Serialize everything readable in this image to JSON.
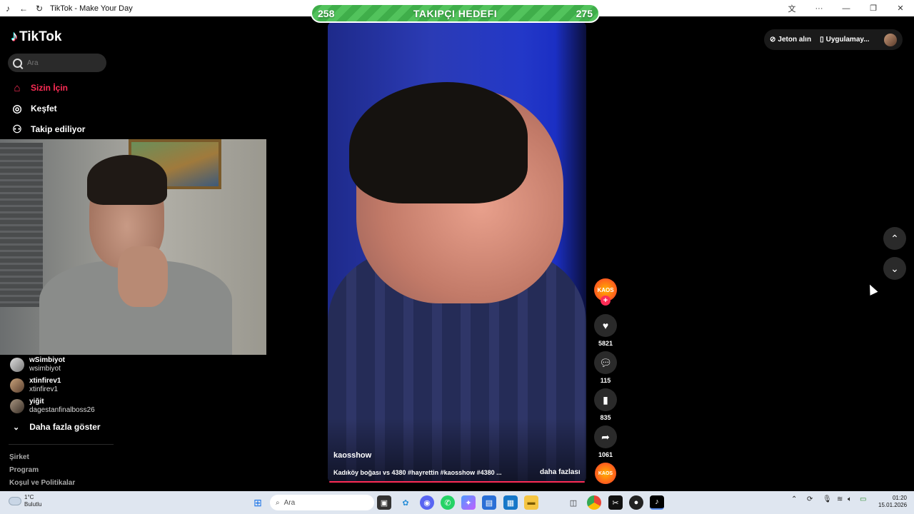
{
  "browser": {
    "tab_title": "TikTok - Make Your Day"
  },
  "goal": {
    "current": "258",
    "title": "TAKIPÇI HEDEFI",
    "target": "275"
  },
  "sidebar": {
    "logo": "TikTok",
    "search_placeholder": "Ara",
    "nav": [
      {
        "label": "Sizin İçin",
        "icon": "home-icon"
      },
      {
        "label": "Keşfet",
        "icon": "compass-icon"
      },
      {
        "label": "Takip ediliyor",
        "icon": "following-icon"
      }
    ],
    "following": [
      {
        "name": "wSimbiyot",
        "username": "wsimbiyot"
      },
      {
        "name": "xtinfirev1",
        "username": "xtinfirev1"
      },
      {
        "name": "yiğit",
        "username": "dagestanfinalboss26"
      }
    ],
    "more_label": "Daha fazla göster",
    "footer": [
      "Şirket",
      "Program",
      "Koşul ve Politikalar"
    ]
  },
  "video": {
    "author": "kaosshow",
    "caption": "Kadıköy boğası vs 4380 #hayrettin #kaosshow #4380 ...",
    "more_label": "daha fazlası",
    "creator_badge": "KAOS",
    "stats": {
      "likes": "5821",
      "comments": "115",
      "saves": "835",
      "shares": "1061"
    }
  },
  "topright": {
    "coin_label": "Jeton alın",
    "app_label": "Uygulamay..."
  },
  "taskbar": {
    "weather_temp": "1°C",
    "weather_desc": "Bulutlu",
    "search_placeholder": "Ara",
    "time": "01:20",
    "date": "15.01.2026"
  }
}
